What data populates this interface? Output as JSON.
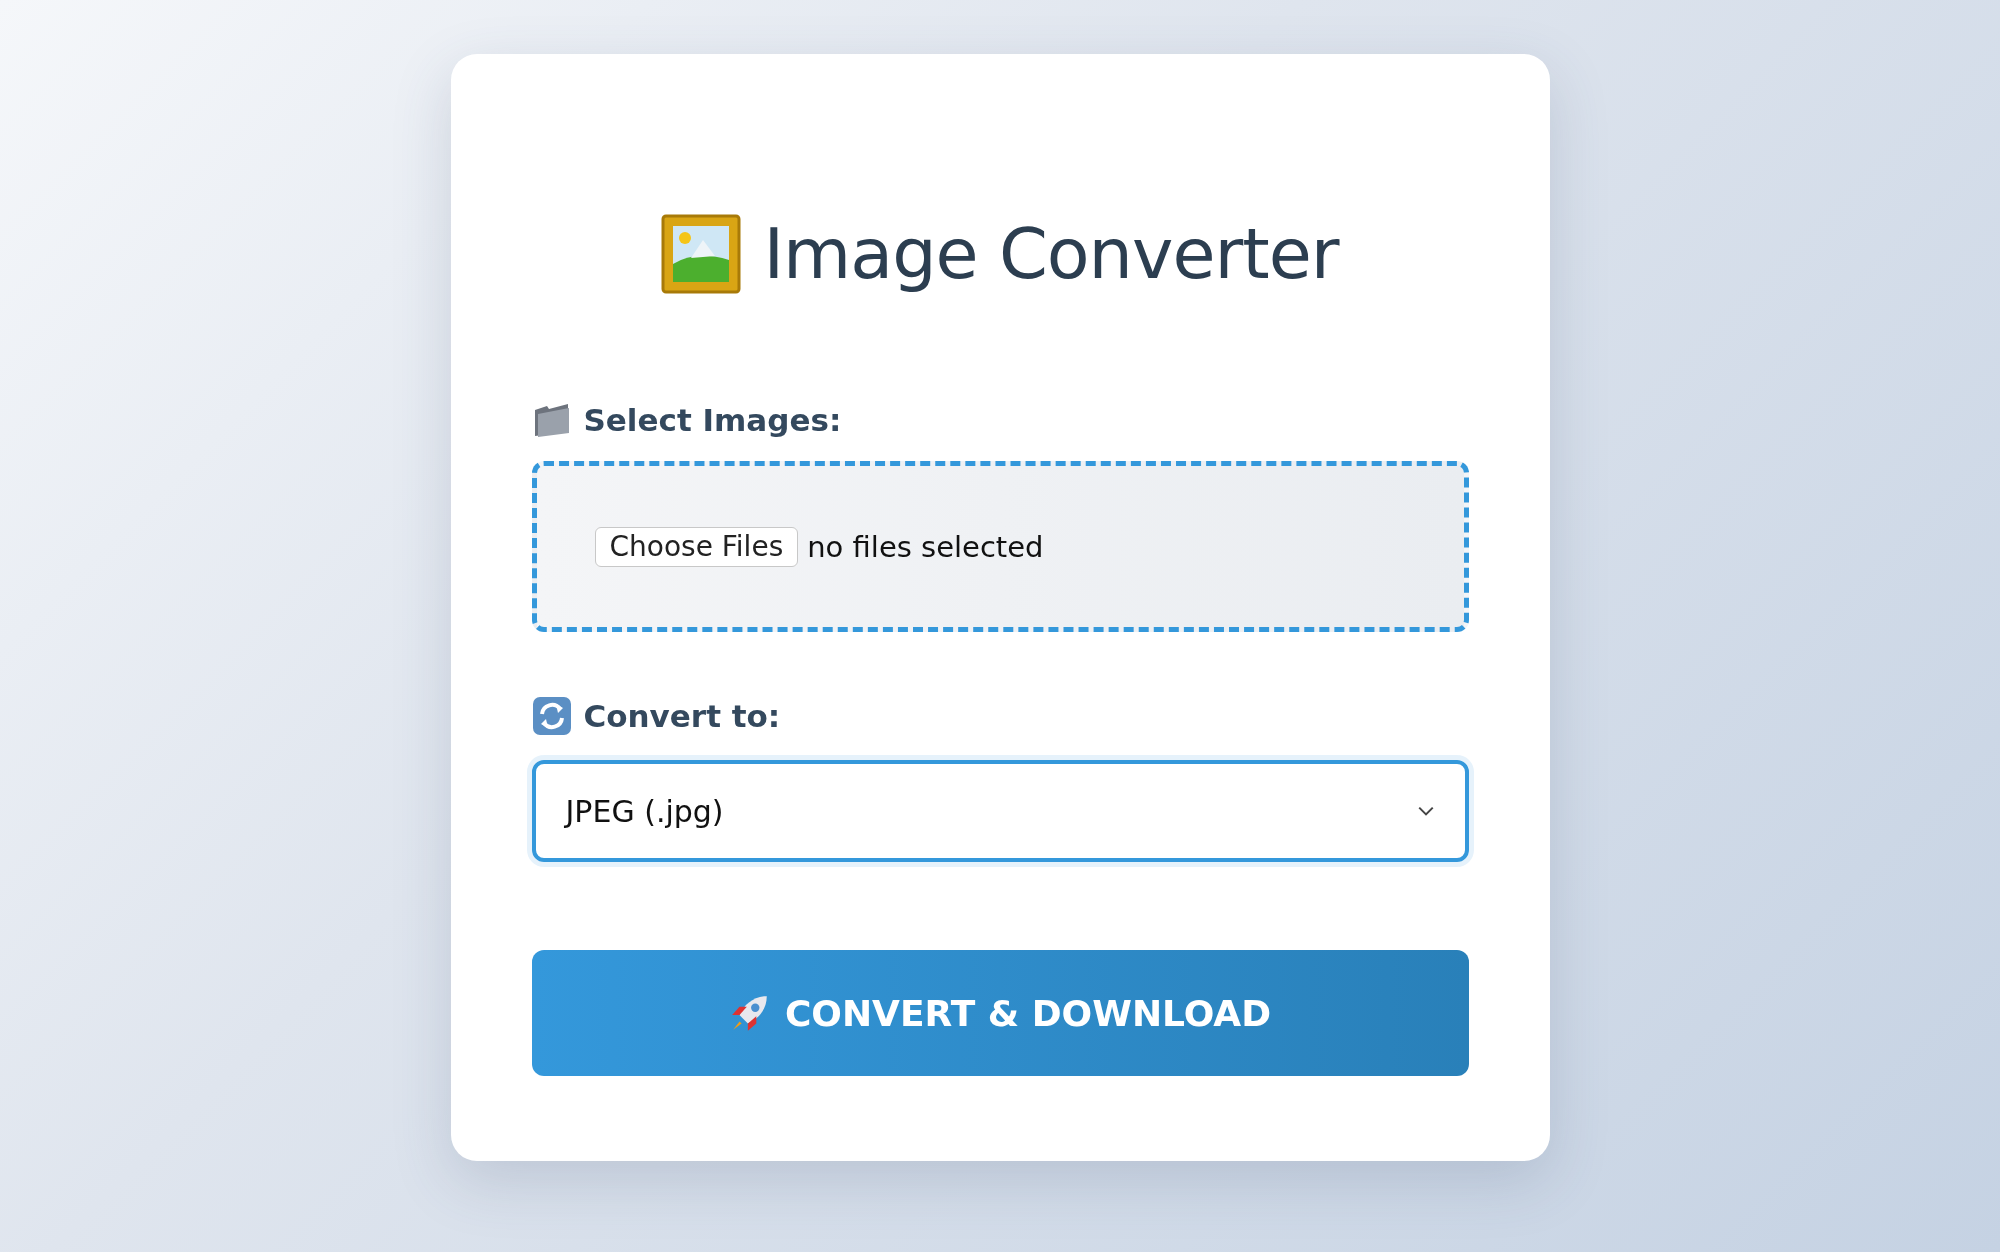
{
  "title": "Image Converter",
  "file_section": {
    "label": "Select Images:",
    "button": "Choose Files",
    "status": "no files selected"
  },
  "format_section": {
    "label": "Convert to:",
    "value": "JPEG (.jpg)"
  },
  "submit_button": "CONVERT & DOWNLOAD"
}
